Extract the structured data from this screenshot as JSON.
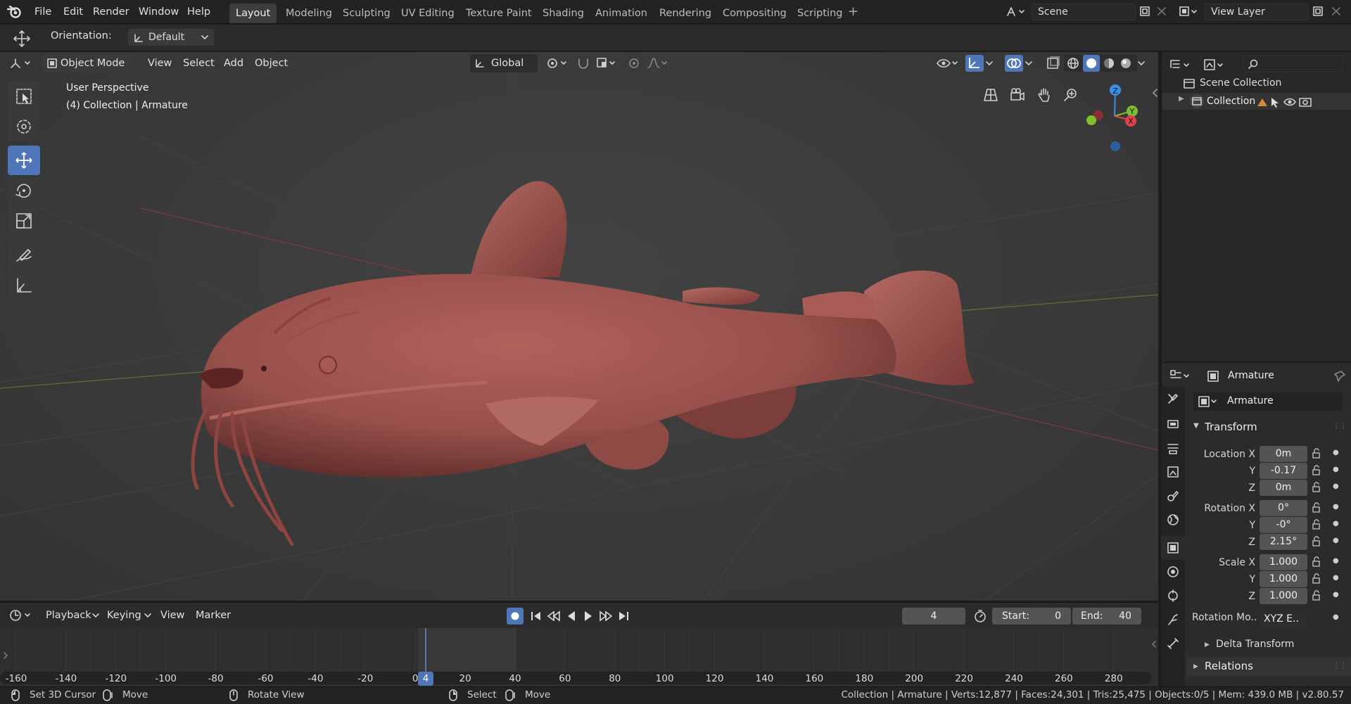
{
  "topbar": {
    "menus": [
      "File",
      "Edit",
      "Render",
      "Window",
      "Help"
    ],
    "workspaces": [
      "Layout",
      "Modeling",
      "Sculpting",
      "UV Editing",
      "Texture Paint",
      "Shading",
      "Animation",
      "Rendering",
      "Compositing",
      "Scripting"
    ],
    "active_workspace": "Layout",
    "scene": "Scene",
    "view_layer": "View Layer"
  },
  "tool_settings": {
    "orientation_label": "Orientation:",
    "orientation_value": "Default"
  },
  "viewport": {
    "mode": "Object Mode",
    "menus": [
      "View",
      "Select",
      "Add",
      "Object"
    ],
    "transform_orientation": "Global",
    "overlay_line1": "User Perspective",
    "overlay_line2": "(4) Collection | Armature",
    "gizmo_axes": [
      "Z",
      "Y",
      "X"
    ]
  },
  "outliner": {
    "root": "Scene Collection",
    "items": [
      {
        "label": "Collection"
      }
    ]
  },
  "properties": {
    "header_object": "Armature",
    "object_name": "Armature",
    "transform_title": "Transform",
    "location_label": "Location X",
    "location": {
      "x": "0m",
      "y": "-0.17",
      "z": "0m"
    },
    "rotation_label": "Rotation X",
    "rotation": {
      "x": "0°",
      "y": "-0°",
      "z": "2.15°"
    },
    "scale_label": "Scale X",
    "scale": {
      "x": "1.000",
      "y": "1.000",
      "z": "1.000"
    },
    "axis_y": "Y",
    "axis_z": "Z",
    "rotation_mode_label": "Rotation Mo..",
    "rotation_mode_value": "XYZ E..",
    "delta_transform": "Delta Transform",
    "relations": "Relations"
  },
  "timeline": {
    "menus": [
      "Playback",
      "Keying",
      "View",
      "Marker"
    ],
    "current_frame": "4",
    "start_label": "Start:",
    "start": "0",
    "end_label": "End:",
    "end": "40",
    "ruler": [
      "-160",
      "-140",
      "-120",
      "-100",
      "-80",
      "-60",
      "-40",
      "-20",
      "0",
      "20",
      "40",
      "60",
      "80",
      "100",
      "120",
      "140",
      "160",
      "180",
      "200",
      "220",
      "240",
      "260",
      "280"
    ],
    "playhead": "4"
  },
  "statusbar": {
    "left_hints": [
      "Set 3D Cursor",
      "Move",
      "Rotate View",
      "Select",
      "Move"
    ],
    "stats": "Collection | Armature | Verts:12,877 | Faces:24,301 | Tris:25,475 | Objects:0/5 | Mem: 439.0 MB | v2.80.57"
  },
  "colors": {
    "accent": "#4f76b8",
    "mesh": "#a0524e",
    "x_axis": "#e0434e",
    "y_axis": "#7fbf2d",
    "z_axis": "#3d8ee5"
  }
}
